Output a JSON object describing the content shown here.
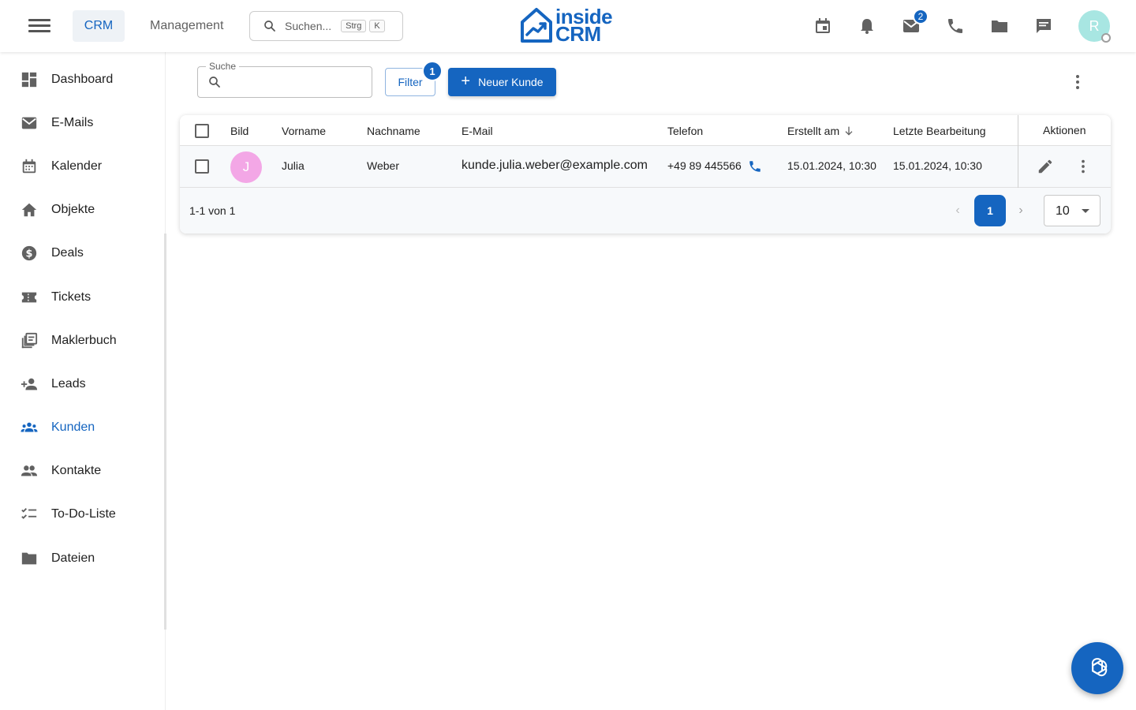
{
  "topbar": {
    "tabs": [
      {
        "label": "CRM"
      },
      {
        "label": "Management"
      }
    ],
    "search_placeholder": "Suchen...",
    "shortcut_keys": [
      "Strg",
      "K"
    ],
    "logo_line1": "inside",
    "logo_line2": "CRM",
    "mail_badge": "2",
    "avatar_initial": "R",
    "icons": [
      "calendar-icon",
      "bell-icon",
      "mail-icon",
      "phone-icon",
      "folder-icon",
      "chat-icon"
    ]
  },
  "sidebar": {
    "items": [
      {
        "label": "Dashboard",
        "icon": "dashboard-icon"
      },
      {
        "label": "E-Mails",
        "icon": "mail-icon"
      },
      {
        "label": "Kalender",
        "icon": "calendar-icon"
      },
      {
        "label": "Objekte",
        "icon": "house-icon"
      },
      {
        "label": "Deals",
        "icon": "dollar-icon"
      },
      {
        "label": "Tickets",
        "icon": "ticket-icon"
      },
      {
        "label": "Maklerbuch",
        "icon": "library-icon"
      },
      {
        "label": "Leads",
        "icon": "person-add-icon"
      },
      {
        "label": "Kunden",
        "icon": "groups-icon",
        "active": true
      },
      {
        "label": "Kontakte",
        "icon": "people-icon"
      },
      {
        "label": "To-Do-Liste",
        "icon": "checklist-icon"
      },
      {
        "label": "Dateien",
        "icon": "folder-icon"
      }
    ]
  },
  "toolbar": {
    "search_label": "Suche",
    "filter_label": "Filter",
    "filter_badge": "1",
    "new_label": "Neuer Kunde"
  },
  "table": {
    "columns": [
      "Bild",
      "Vorname",
      "Nachname",
      "E-Mail",
      "Telefon",
      "Erstellt am",
      "Letzte Bearbeitung",
      "Aktionen"
    ],
    "rows": [
      {
        "initial": "J",
        "vorname": "Julia",
        "nachname": "Weber",
        "email": "kunde.julia.weber@example.com",
        "telefon": "+49 89 445566",
        "erstellt": "15.01.2024, 10:30",
        "bearbeitet": "15.01.2024, 10:30"
      }
    ],
    "pagination": {
      "range_text": "1-1 von 1",
      "current_page": "1",
      "page_size": "10"
    }
  },
  "colors": {
    "primary": "#1565c0",
    "avatar_row": "#f3a7e6",
    "avatar_user": "#a8e6e2"
  }
}
